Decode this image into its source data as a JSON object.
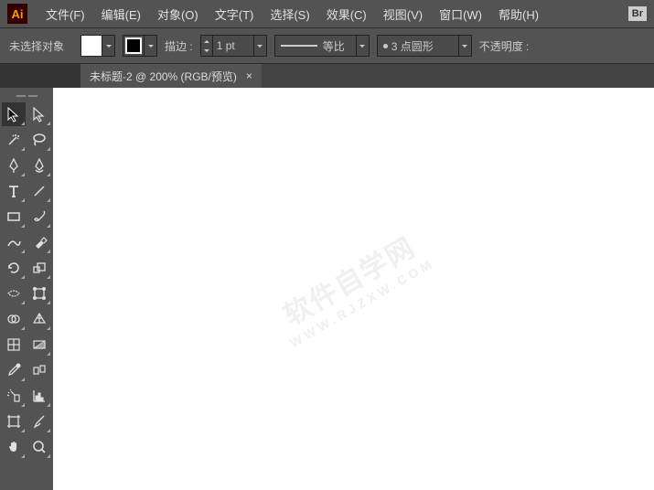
{
  "app": {
    "logo": "Ai",
    "bridge": "Br"
  },
  "menu": [
    "文件(F)",
    "编辑(E)",
    "对象(O)",
    "文字(T)",
    "选择(S)",
    "效果(C)",
    "视图(V)",
    "窗口(W)",
    "帮助(H)"
  ],
  "optbar": {
    "noSelection": "未选择对象",
    "strokeLabel": "描边 :",
    "strokeValue": "1 pt",
    "profileLabel": "等比",
    "brushLabel": "3 点圆形",
    "opacityLabel": "不透明度 :"
  },
  "tab": {
    "title": "未标题-2 @ 200% (RGB/预览)",
    "close": "×"
  },
  "watermark": {
    "main": "软件自学网",
    "sub": "WWW.RJZXW.COM"
  },
  "toolNames": [
    [
      "selection",
      "direct-selection"
    ],
    [
      "magic-wand",
      "lasso"
    ],
    [
      "pen",
      "curvature"
    ],
    [
      "type",
      "line-segment"
    ],
    [
      "rectangle",
      "paintbrush"
    ],
    [
      "shaper",
      "eraser"
    ],
    [
      "rotate",
      "scale"
    ],
    [
      "width",
      "free-transform"
    ],
    [
      "shape-builder",
      "perspective"
    ],
    [
      "mesh",
      "gradient"
    ],
    [
      "eyedropper",
      "blend"
    ],
    [
      "symbol-sprayer",
      "column-graph"
    ],
    [
      "artboard",
      "slice"
    ],
    [
      "hand",
      "zoom"
    ]
  ]
}
